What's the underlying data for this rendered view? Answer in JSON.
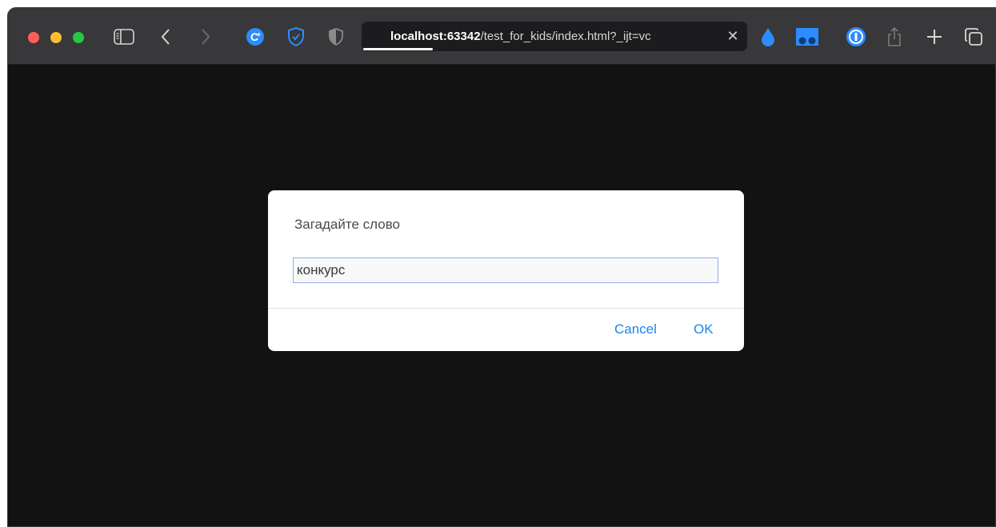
{
  "browser": {
    "url_host": "localhost:63342",
    "url_path": "/test_for_kids/index.html?_ijt=vc",
    "load_progress": 0.18
  },
  "dialog": {
    "message": "Загадайте слово",
    "input_value": "конкурс",
    "cancel_label": "Cancel",
    "ok_label": "OK"
  },
  "colors": {
    "accent": "#1a84f2",
    "toolbar": "#38383a",
    "page_bg": "#121212"
  }
}
